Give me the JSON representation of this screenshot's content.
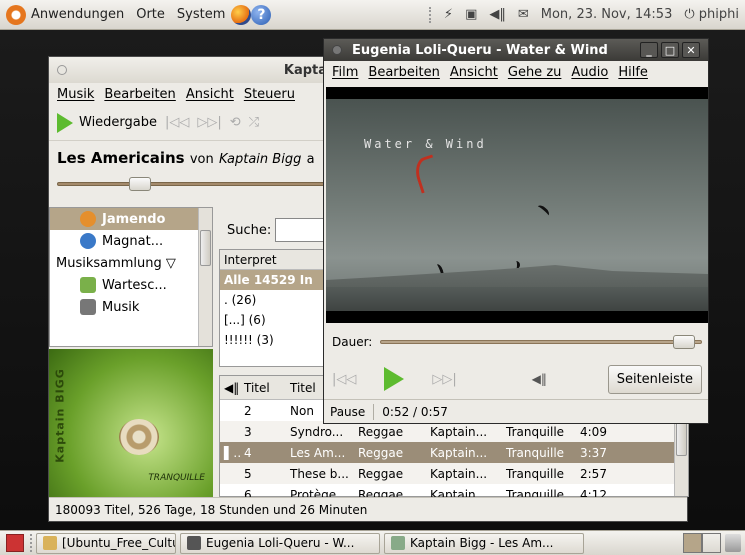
{
  "top_panel": {
    "menus": [
      "Anwendungen",
      "Orte",
      "System"
    ],
    "clock": "Mon, 23. Nov, 14:53",
    "user": "phiphi"
  },
  "rhythmbox": {
    "title": "Kaptain Bigg - Les A",
    "menu": [
      "Musik",
      "Bearbeiten",
      "Ansicht",
      "Steueru"
    ],
    "play_label": "Wiedergabe",
    "now_playing": {
      "song": "Les Americains",
      "von": "von",
      "artist": "Kaptain Bigg",
      "trail": "a"
    },
    "seek_fraction": 0.28,
    "sources": [
      {
        "label": "Jamendo",
        "selected": true
      },
      {
        "label": "Magnat...",
        "selected": false
      },
      {
        "label": "Musiksammlung ▽",
        "selected": false
      },
      {
        "label": "Wartesc...",
        "selected": false
      },
      {
        "label": "Musik",
        "selected": false
      }
    ],
    "search_label": "Suche:",
    "browser_header": "Interpret",
    "browser_rows": [
      "Alle 14529 In",
      ". (26)",
      "[...] (6)",
      "!!!!!! (3)"
    ],
    "track_columns": [
      "Titel",
      "Titel",
      "",
      "",
      "",
      ""
    ],
    "tracks": [
      {
        "state": "",
        "num": "2",
        "title": "Non",
        "genre": "",
        "artist": "",
        "album": "",
        "time": ""
      },
      {
        "state": "",
        "num": "3",
        "title": "Syndro...",
        "genre": "Reggae",
        "artist": "Kaptain...",
        "album": "Tranquille",
        "time": "4:09"
      },
      {
        "state": "▌▌",
        "num": "4",
        "title": "Les Am...",
        "genre": "Reggae",
        "artist": "Kaptain...",
        "album": "Tranquille",
        "time": "3:37"
      },
      {
        "state": "",
        "num": "5",
        "title": "These b...",
        "genre": "Reggae",
        "artist": "Kaptain...",
        "album": "Tranquille",
        "time": "2:57"
      },
      {
        "state": "",
        "num": "6",
        "title": "Protège...",
        "genre": "Reggae",
        "artist": "Kaptain...",
        "album": "Tranquille",
        "time": "4:12"
      }
    ],
    "status": "180093 Titel, 526 Tage, 18 Stunden und 26 Minuten",
    "album_art_text": "Kaptain BIGG",
    "album_brand": "TRANQUILLE"
  },
  "totem": {
    "title": "Eugenia Loli-Queru - Water & Wind",
    "menu": [
      "Film",
      "Bearbeiten",
      "Ansicht",
      "Gehe zu",
      "Audio",
      "Hilfe"
    ],
    "video_caption": "Water & Wind",
    "dauer_label": "Dauer:",
    "seek_fraction": 0.93,
    "sidebar_btn": "Seitenleiste",
    "state": "Pause",
    "time": "0:52 / 0:57"
  },
  "taskbar": {
    "tasks": [
      {
        "label": "[Ubuntu_Free_Culture...",
        "color": "#d9b25a"
      },
      {
        "label": "Eugenia Loli-Queru - W...",
        "color": "#555"
      },
      {
        "label": "Kaptain Bigg - Les Am...",
        "color": "#8a8"
      }
    ]
  },
  "colors": {
    "accent": "#b5a589",
    "play": "#5dbb2f",
    "panel": "#e6e3dc"
  }
}
